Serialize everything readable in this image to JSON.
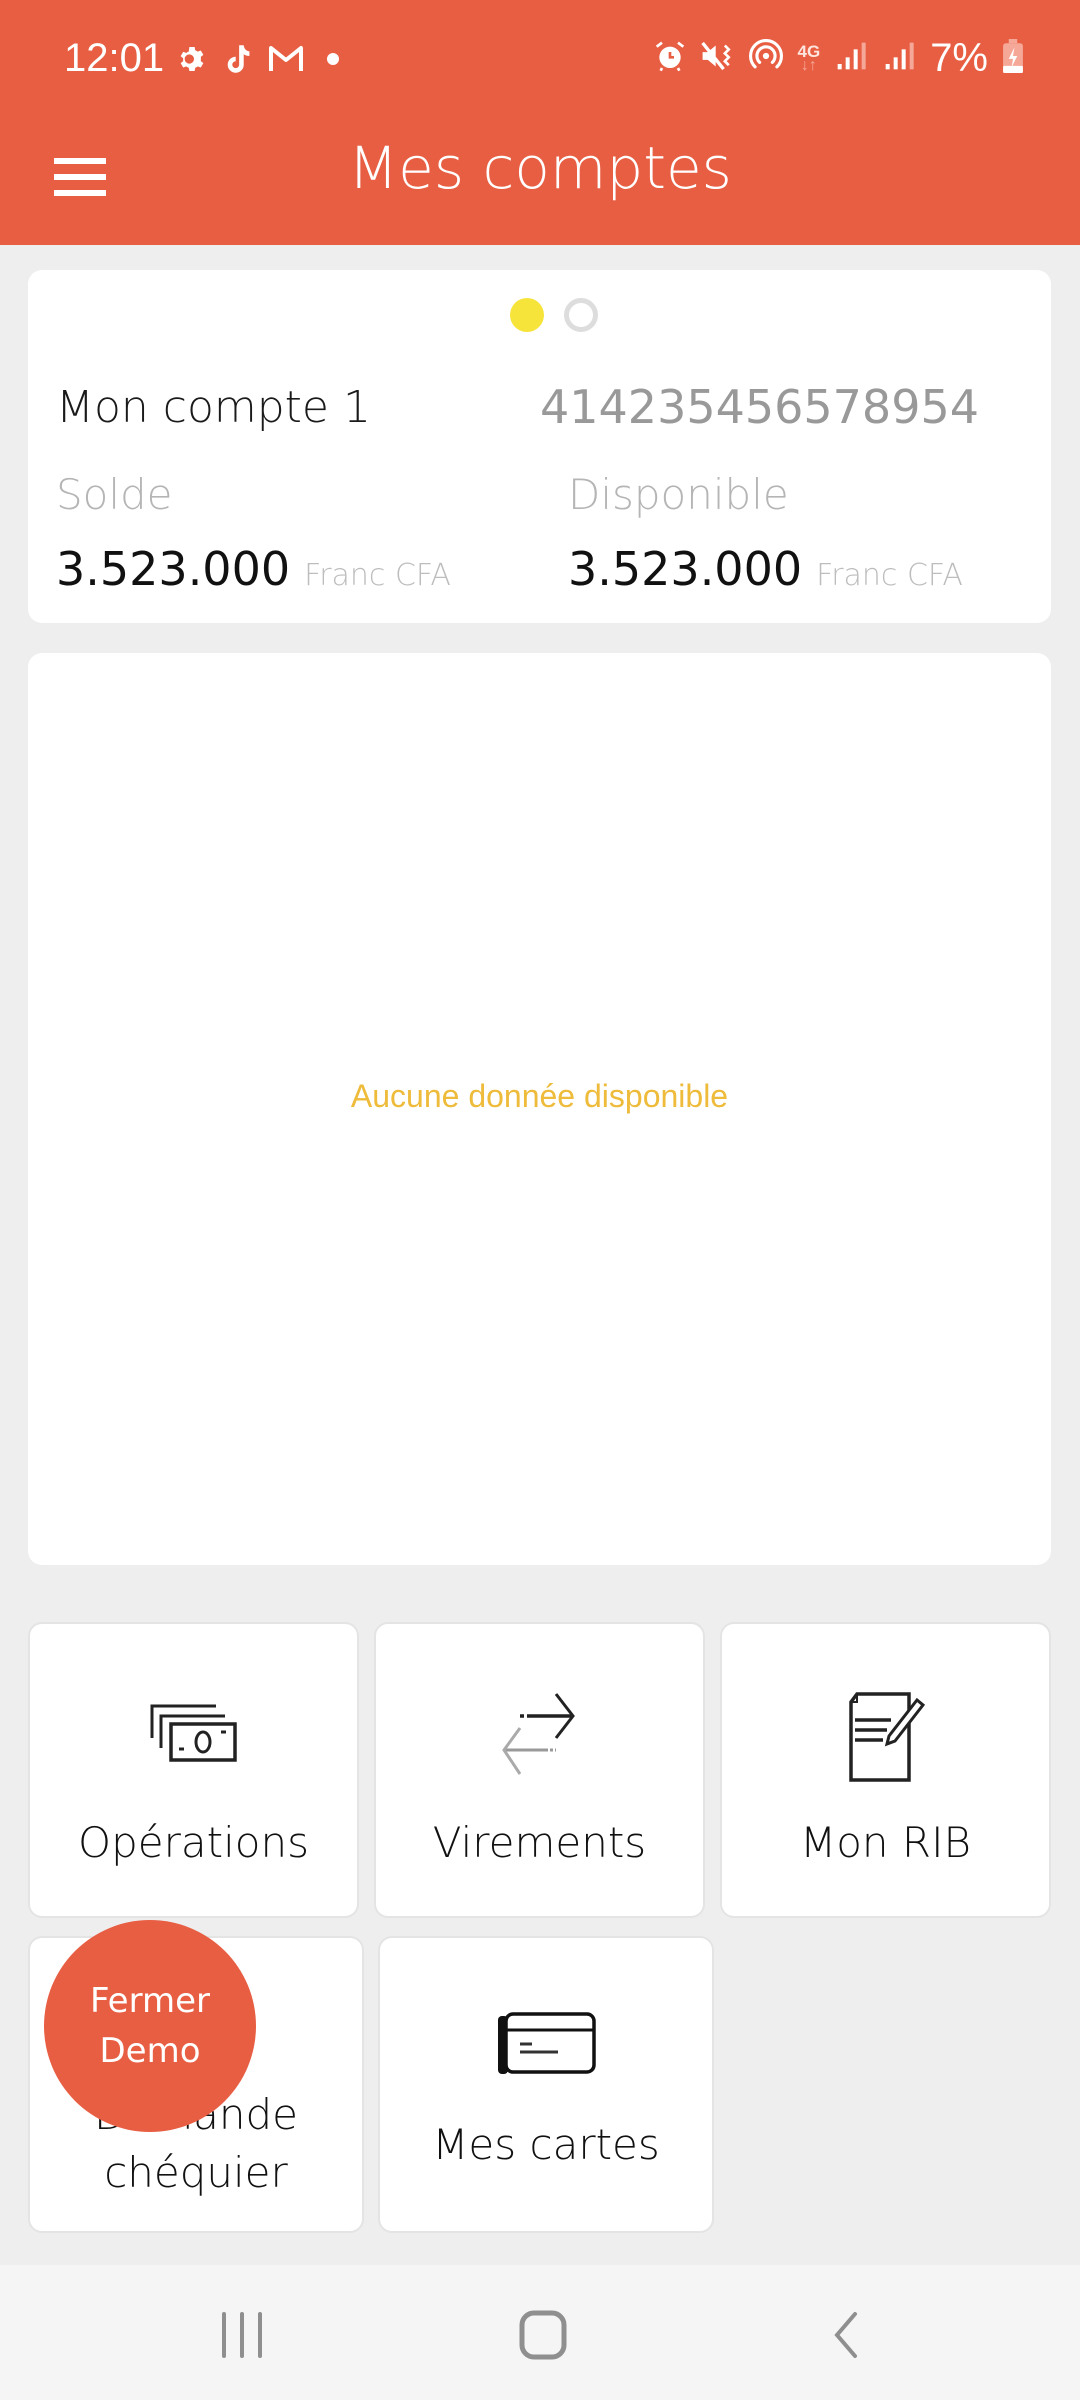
{
  "status_bar": {
    "time": "12:01",
    "left_icons": [
      "settings-icon",
      "tiktok-icon",
      "gmail-icon",
      "notification-dot-icon"
    ],
    "right_icons": [
      "alarm-icon",
      "vibrate-mute-icon",
      "hotspot-icon",
      "4g-data-icon",
      "signal-icon",
      "signal-icon"
    ],
    "network": "4G",
    "battery": "7%"
  },
  "app_bar": {
    "title": "Mes comptes",
    "menu_icon": "hamburger-menu-icon"
  },
  "account_card": {
    "pager": {
      "count": 2,
      "active_index": 0
    },
    "name": "Mon compte 1",
    "number": "414235456578954",
    "balance_label": "Solde",
    "balance_amount": "3.523.000",
    "balance_currency": "Franc CFA",
    "available_label": "Disponible",
    "available_amount": "3.523.000",
    "available_currency": "Franc CFA"
  },
  "chart_card": {
    "empty_message": "Aucune donnée disponible"
  },
  "tiles": [
    {
      "label": "Opérations",
      "icon": "banknotes-icon"
    },
    {
      "label": "Virements",
      "icon": "transfer-arrows-icon"
    },
    {
      "label": "Mon RIB",
      "icon": "document-edit-icon"
    },
    {
      "label": "Demande chéquier",
      "label_line1": "Demande",
      "label_line2": "chéquier",
      "icon": "checkbook-icon"
    },
    {
      "label": "Mes cartes",
      "icon": "credit-card-icon"
    }
  ],
  "fab": {
    "line1": "Fermer",
    "line2": "Demo"
  },
  "nav_bar": {
    "recents": "recent-apps-icon",
    "home": "home-icon",
    "back": "back-icon"
  },
  "colors": {
    "brand": "#e85e43",
    "pager_active": "#f7e43a",
    "empty_text": "#eebb3a",
    "background": "#eeeeee"
  }
}
